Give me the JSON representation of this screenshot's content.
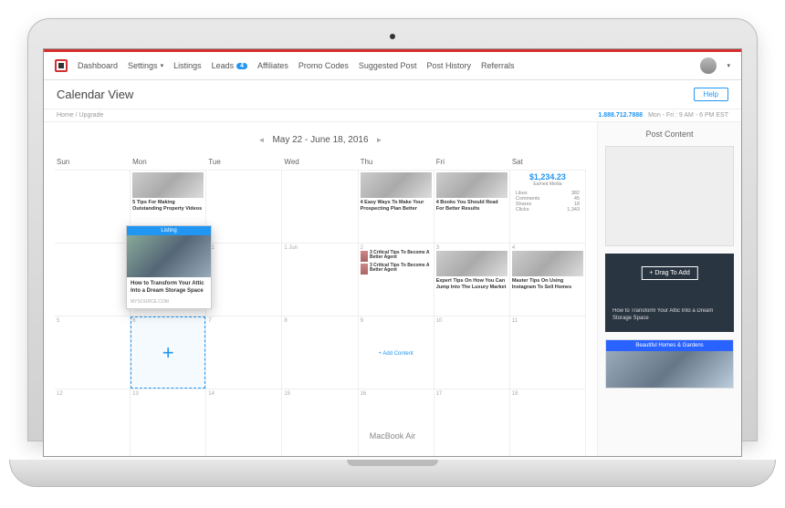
{
  "brand": "MacBook Air",
  "nav": {
    "items": [
      "Dashboard",
      "Settings",
      "Listings",
      "Leads",
      "Affiliates",
      "Promo Codes",
      "Suggested Post",
      "Post History",
      "Referrals"
    ],
    "leads_badge": "4"
  },
  "header": {
    "title": "Calendar View",
    "help": "Help"
  },
  "crumbs": {
    "path": "Home / Upgrade",
    "phone": "1.888.712.7888",
    "hours": "Mon - Fri : 9 AM - 6 PM EST"
  },
  "range": "May 22 - June 18, 2016",
  "days": [
    "Sun",
    "Mon",
    "Tue",
    "Wed",
    "Thu",
    "Fri",
    "Sat"
  ],
  "cells": {
    "r0c1": {
      "cap": "5 Tips For Making Outstanding Property Videos"
    },
    "r0c4": {
      "cap": "4 Easy Ways To Make Your Prospecting Plan Better"
    },
    "r0c5": {
      "cap": "4 Books You Should Read For Better Results"
    },
    "r0c6": {
      "earned": "$1,234.23",
      "earned_sub": "Earned Media",
      "stats": [
        [
          "Likes",
          "382"
        ],
        [
          "Comments",
          "45"
        ],
        [
          "Shares",
          "18"
        ],
        [
          "Clicks",
          "1,343"
        ]
      ]
    },
    "r1c2": {
      "num": "31"
    },
    "r1c3": {
      "num": "1 Jun"
    },
    "r1c4": {
      "num": "2",
      "mini": [
        {
          "t": "3 Critical Tips To Become A Better Agent"
        },
        {
          "t": "3 Critical Tips To Become A Better Agent"
        }
      ]
    },
    "r1c5": {
      "num": "3",
      "cap": "Expert Tips On How You Can Jump Into The Luxury Market"
    },
    "r1c6": {
      "num": "4",
      "cap": "Master Tips On Using Instagram To Sell Homes"
    },
    "r2c0": {
      "num": "5"
    },
    "r2c1": {
      "num": "6"
    },
    "r2c2": {
      "num": "7"
    },
    "r2c3": {
      "num": "8"
    },
    "r2c4": {
      "num": "9",
      "add": "+ Add Content"
    },
    "r2c5": {
      "num": "10"
    },
    "r2c6": {
      "num": "11"
    },
    "r3c0": {
      "num": "12"
    },
    "r3c1": {
      "num": "13"
    },
    "r3c2": {
      "num": "14"
    },
    "r3c3": {
      "num": "15"
    },
    "r3c4": {
      "num": "16"
    },
    "r3c5": {
      "num": "17"
    },
    "r3c6": {
      "num": "18"
    }
  },
  "card": {
    "head": "Listing",
    "title": "How to Transform Your Attic Into a Dream Storage Space",
    "src": "MYSOURCE.COM"
  },
  "side": {
    "title": "Post Content",
    "drag": "+ Drag To Add",
    "drag_txt": "How to Transform Your Attic Into a Dream Storage Space",
    "card2": "Beautiful Homes & Gardens"
  }
}
